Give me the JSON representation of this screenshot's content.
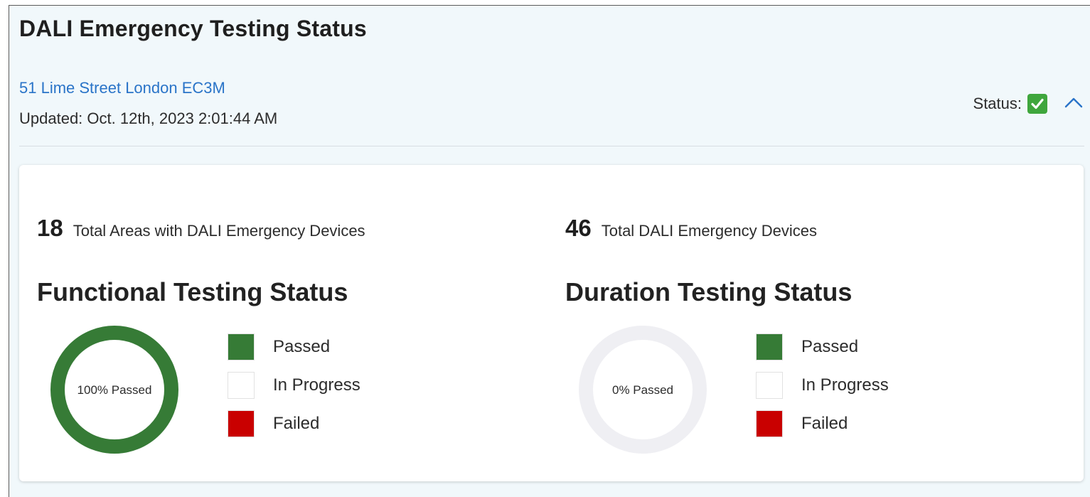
{
  "header": {
    "title": "DALI Emergency Testing Status",
    "address": "51 Lime Street London EC3M",
    "updated": "Updated: Oct. 12th, 2023 2:01:44 AM",
    "status_label": "Status:",
    "status_icon": "check-box-icon",
    "collapse_icon": "chevron-up-icon"
  },
  "colors": {
    "passed": "#367b36",
    "in_progress": "#ffffff",
    "failed": "#c90000",
    "empty_ring": "#efeff3",
    "link": "#2a74c8",
    "status_ok": "#3fa63d"
  },
  "functional": {
    "count": "18",
    "count_label": "Total Areas with DALI Emergency Devices",
    "title": "Functional Testing Status",
    "center_text": "100% Passed",
    "passed_fraction": 1.0,
    "legend": [
      {
        "label": "Passed"
      },
      {
        "label": "In Progress"
      },
      {
        "label": "Failed"
      }
    ]
  },
  "duration": {
    "count": "46",
    "count_label": "Total DALI Emergency Devices",
    "title": "Duration Testing Status",
    "center_text": "0% Passed",
    "passed_fraction": 0.0,
    "legend": [
      {
        "label": "Passed"
      },
      {
        "label": "In Progress"
      },
      {
        "label": "Failed"
      }
    ]
  }
}
